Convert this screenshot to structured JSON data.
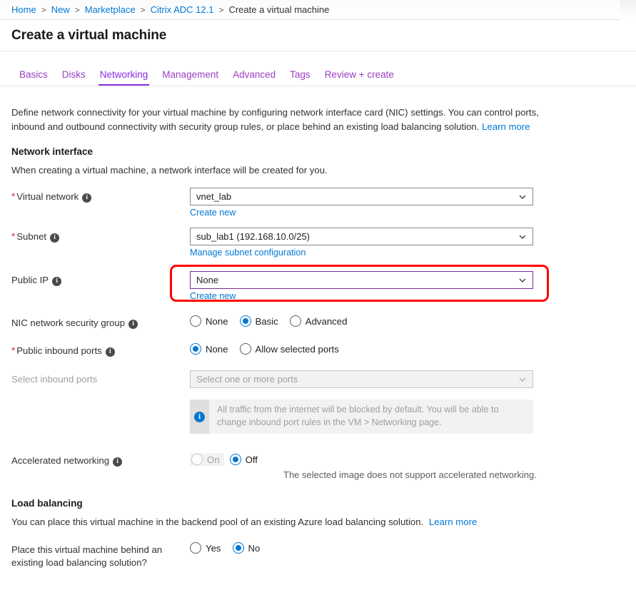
{
  "breadcrumb": {
    "items": [
      {
        "label": "Home",
        "current": false
      },
      {
        "label": "New",
        "current": false
      },
      {
        "label": "Marketplace",
        "current": false
      },
      {
        "label": "Citrix ADC 12.1",
        "current": false
      },
      {
        "label": "Create a virtual machine",
        "current": true
      }
    ],
    "separator": ">"
  },
  "header": {
    "title": "Create a virtual machine"
  },
  "tabs": [
    {
      "label": "Basics",
      "active": false
    },
    {
      "label": "Disks",
      "active": false
    },
    {
      "label": "Networking",
      "active": true
    },
    {
      "label": "Management",
      "active": false
    },
    {
      "label": "Advanced",
      "active": false
    },
    {
      "label": "Tags",
      "active": false
    },
    {
      "label": "Review + create",
      "active": false
    }
  ],
  "intro": {
    "text": "Define network connectivity for your virtual machine by configuring network interface card (NIC) settings. You can control ports, inbound and outbound connectivity with security group rules, or place behind an existing load balancing solution.",
    "link": "Learn more"
  },
  "network_interface": {
    "heading": "Network interface",
    "subtext": "When creating a virtual machine, a network interface will be created for you.",
    "virtual_network": {
      "label": "Virtual network",
      "required": true,
      "info_icon": "info-icon",
      "value": "vnet_lab",
      "link": "Create new"
    },
    "subnet": {
      "label": "Subnet",
      "required": true,
      "info_icon": "info-icon",
      "value": "sub_lab1 (192.168.10.0/25)",
      "link": "Manage subnet configuration"
    },
    "public_ip": {
      "label": "Public IP",
      "required": false,
      "info_icon": "info-icon",
      "value": "None",
      "link": "Create new",
      "highlight_color": "#ff0000",
      "focus_border_color": "#7b2d94"
    },
    "nic_nsg": {
      "label": "NIC network security group",
      "required": false,
      "info_icon": "info-icon",
      "options": [
        {
          "label": "None",
          "checked": false
        },
        {
          "label": "Basic",
          "checked": true
        },
        {
          "label": "Advanced",
          "checked": false
        }
      ]
    },
    "public_inbound_ports": {
      "label": "Public inbound ports",
      "required": true,
      "info_icon": "info-icon",
      "options": [
        {
          "label": "None",
          "checked": true
        },
        {
          "label": "Allow selected ports",
          "checked": false
        }
      ]
    },
    "select_inbound_ports": {
      "label": "Select inbound ports",
      "placeholder": "Select one or more ports",
      "disabled": true
    },
    "inbound_banner": {
      "icon": "info-circle-icon",
      "text": "All traffic from the internet will be blocked by default. You will be able to change inbound port rules in the VM > Networking page."
    },
    "accelerated_networking": {
      "label": "Accelerated networking",
      "required": false,
      "info_icon": "info-icon",
      "options": [
        {
          "label": "On",
          "checked": false,
          "disabled": true
        },
        {
          "label": "Off",
          "checked": true,
          "disabled": false
        }
      ],
      "note": "The selected image does not support accelerated networking."
    }
  },
  "load_balancing": {
    "heading": "Load balancing",
    "subtext": "You can place this virtual machine in the backend pool of an existing Azure load balancing solution.",
    "link": "Learn more",
    "question": {
      "label_line1": "Place this virtual machine behind an",
      "label_line2": "existing load balancing solution?",
      "options": [
        {
          "label": "Yes",
          "checked": false
        },
        {
          "label": "No",
          "checked": true
        }
      ]
    }
  }
}
